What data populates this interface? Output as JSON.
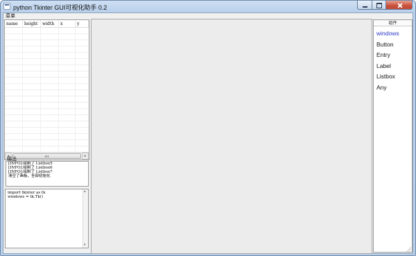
{
  "window": {
    "title": "python Tkinter GUI可视化助手 0.2"
  },
  "menubar": {
    "items": [
      "菜单"
    ]
  },
  "properties": {
    "columns": [
      "name",
      "height",
      "width",
      "x",
      "y"
    ]
  },
  "output": {
    "label": "输出",
    "lines": [
      "[INFO]:绘制了 Listbox5",
      "[INFO]:绘制了 Listbox6",
      "[INFO]:绘制了 Listbox7",
      "清空了画板，全部初始化"
    ]
  },
  "code": {
    "lines": [
      "import tkinter as tk",
      "windows = tk.Tk()"
    ]
  },
  "components": {
    "header": "组件",
    "items": [
      "windows",
      "Button",
      "Entry",
      "Label",
      "Listbox",
      "Any"
    ],
    "selected_index": 0,
    "selected_color": "#2a36c8"
  }
}
